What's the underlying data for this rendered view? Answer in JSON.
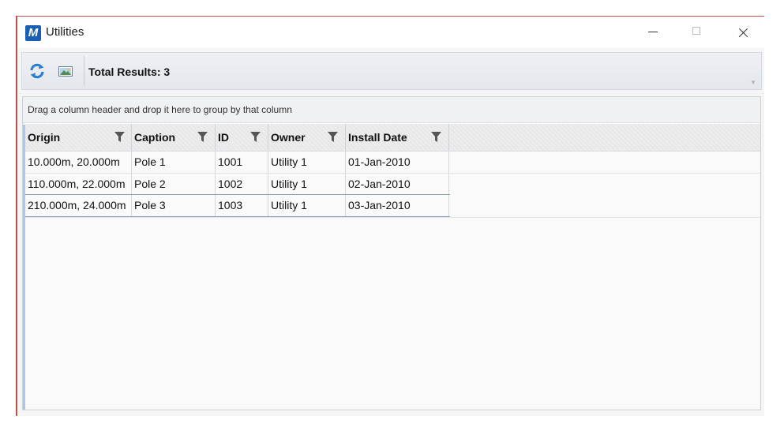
{
  "window": {
    "title": "Utilities",
    "app_icon_letter": "M"
  },
  "toolbar": {
    "total_results": "Total Results: 3",
    "icons": {
      "refresh": "refresh-icon",
      "export": "export-image-icon"
    }
  },
  "grid": {
    "group_hint": "Drag a column header and drop it here to group by that column",
    "columns": [
      "Origin",
      "Caption",
      "ID",
      "Owner",
      "Install Date"
    ],
    "rows": [
      [
        "10.000m, 20.000m",
        "Pole 1",
        "1001",
        "Utility 1",
        "01-Jan-2010"
      ],
      [
        "110.000m, 22.000m",
        "Pole 2",
        "1002",
        "Utility 1",
        "02-Jan-2010"
      ],
      [
        "210.000m, 24.000m",
        "Pole 3",
        "1003",
        "Utility 1",
        "03-Jan-2010"
      ]
    ]
  },
  "colors": {
    "accent_blue": "#1a5fb4",
    "refresh_blue": "#2a7fd4",
    "window_border": "#c0504d"
  }
}
